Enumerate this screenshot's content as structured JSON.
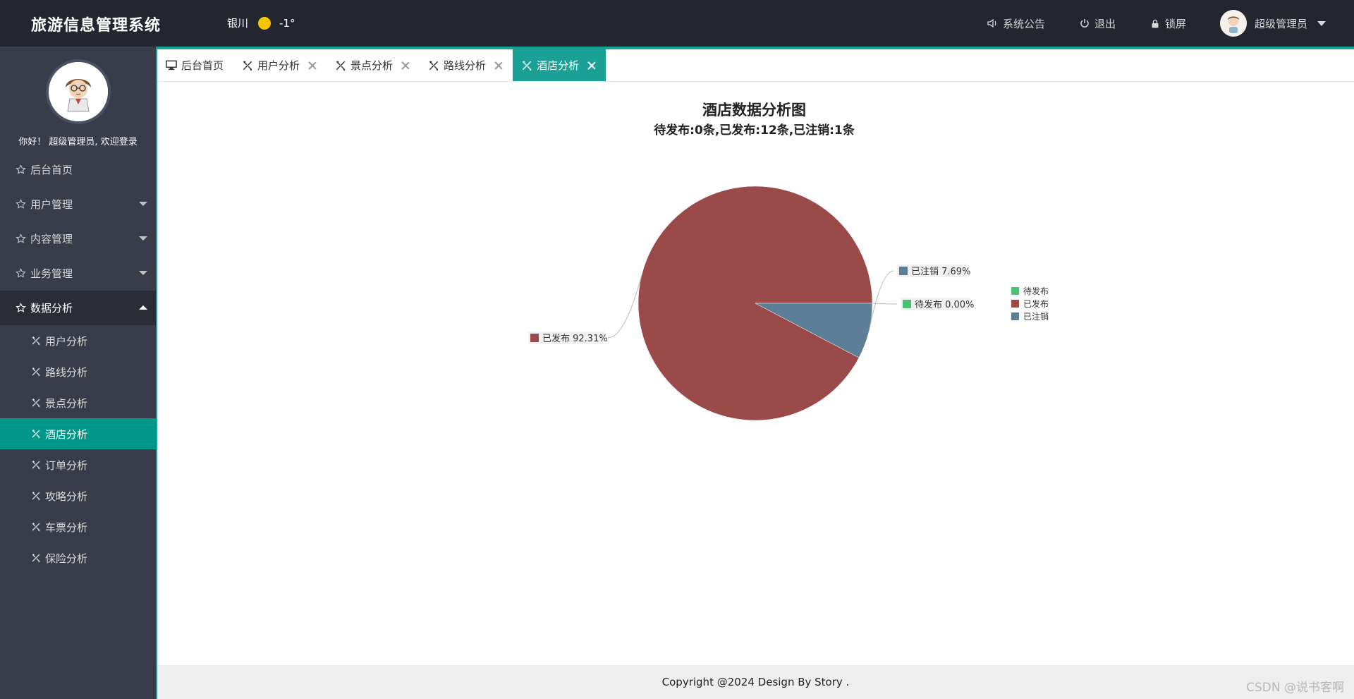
{
  "header": {
    "app_title": "旅游信息管理系统",
    "weather": {
      "city": "银川",
      "temperature": "-1°"
    },
    "announcement_label": "系统公告",
    "logout_label": "退出",
    "lock_label": "锁屏",
    "username": "超级管理员"
  },
  "sidebar": {
    "welcome_text": "你好！ 超级管理员, 欢迎登录",
    "items": [
      {
        "label": "后台首页"
      },
      {
        "label": "用户管理"
      },
      {
        "label": "内容管理"
      },
      {
        "label": "业务管理"
      },
      {
        "label": "数据分析"
      }
    ],
    "sub_items": [
      {
        "label": "用户分析"
      },
      {
        "label": "路线分析"
      },
      {
        "label": "景点分析"
      },
      {
        "label": "酒店分析"
      },
      {
        "label": "订单分析"
      },
      {
        "label": "攻略分析"
      },
      {
        "label": "车票分析"
      },
      {
        "label": "保险分析"
      }
    ]
  },
  "tabs": [
    {
      "label": "后台首页"
    },
    {
      "label": "用户分析"
    },
    {
      "label": "景点分析"
    },
    {
      "label": "路线分析"
    },
    {
      "label": "酒店分析"
    }
  ],
  "chart_data": {
    "type": "pie",
    "title": "酒店数据分析图",
    "subtitle": "待发布:0条,已发布:12条,已注销:1条",
    "categories": [
      "待发布",
      "已发布",
      "已注销"
    ],
    "values": [
      0,
      12,
      1
    ],
    "percent_labels": [
      "待发布 0.00%",
      "已发布 92.31%",
      "已注销 7.69%"
    ],
    "colors": [
      "#4bbf73",
      "#9b4a4a",
      "#5c7e96"
    ],
    "legend": {
      "placement": "right",
      "entries": [
        "待发布",
        "已发布",
        "已注销"
      ]
    }
  },
  "footer": {
    "copyright": "Copyright @2024 Design By Story ."
  },
  "watermark": "CSDN @说书客啊"
}
